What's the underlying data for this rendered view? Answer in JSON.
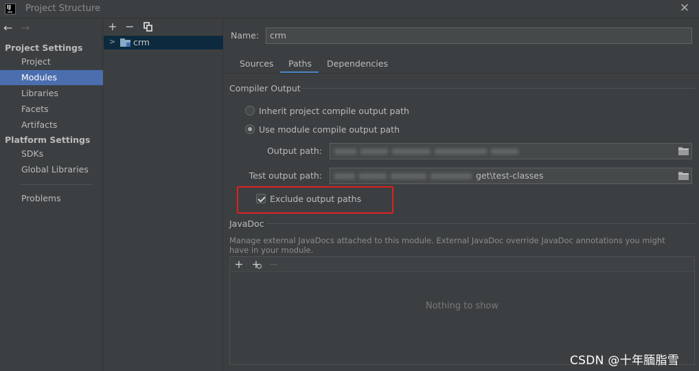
{
  "window": {
    "app_icon_text": "IJ",
    "title": "Project Structure"
  },
  "nav": {
    "project_settings_header": "Project Settings",
    "project_items": [
      "Project",
      "Modules",
      "Libraries",
      "Facets",
      "Artifacts"
    ],
    "selected": "Modules",
    "platform_settings_header": "Platform Settings",
    "platform_items": [
      "SDKs",
      "Global Libraries"
    ],
    "problems": "Problems"
  },
  "tree": {
    "module": "crm"
  },
  "module": {
    "name_label": "Name:",
    "name_value": "crm",
    "tabs": [
      "Sources",
      "Paths",
      "Dependencies"
    ],
    "active_tab": "Paths"
  },
  "compiler_output": {
    "title": "Compiler Output",
    "inherit_label": "Inherit project compile output path",
    "use_module_label": "Use module compile output path",
    "selected_option": "use_module",
    "output_path_label": "Output path:",
    "test_output_path_label": "Test output path:",
    "test_output_path_visible_suffix": "get\\test-classes",
    "exclude_label": "Exclude output paths",
    "exclude_checked": true
  },
  "javadoc": {
    "title": "JavaDoc",
    "description": "Manage external JavaDocs attached to this module. External JavaDoc override JavaDoc annotations you might have in your module.",
    "empty_text": "Nothing to show"
  },
  "watermark": "CSDN @十年腼脂雪",
  "colors": {
    "background": "#3c3f41",
    "selection": "#4b6eaf",
    "tab_accent": "#4a88c7",
    "highlight_box": "#e02020"
  }
}
